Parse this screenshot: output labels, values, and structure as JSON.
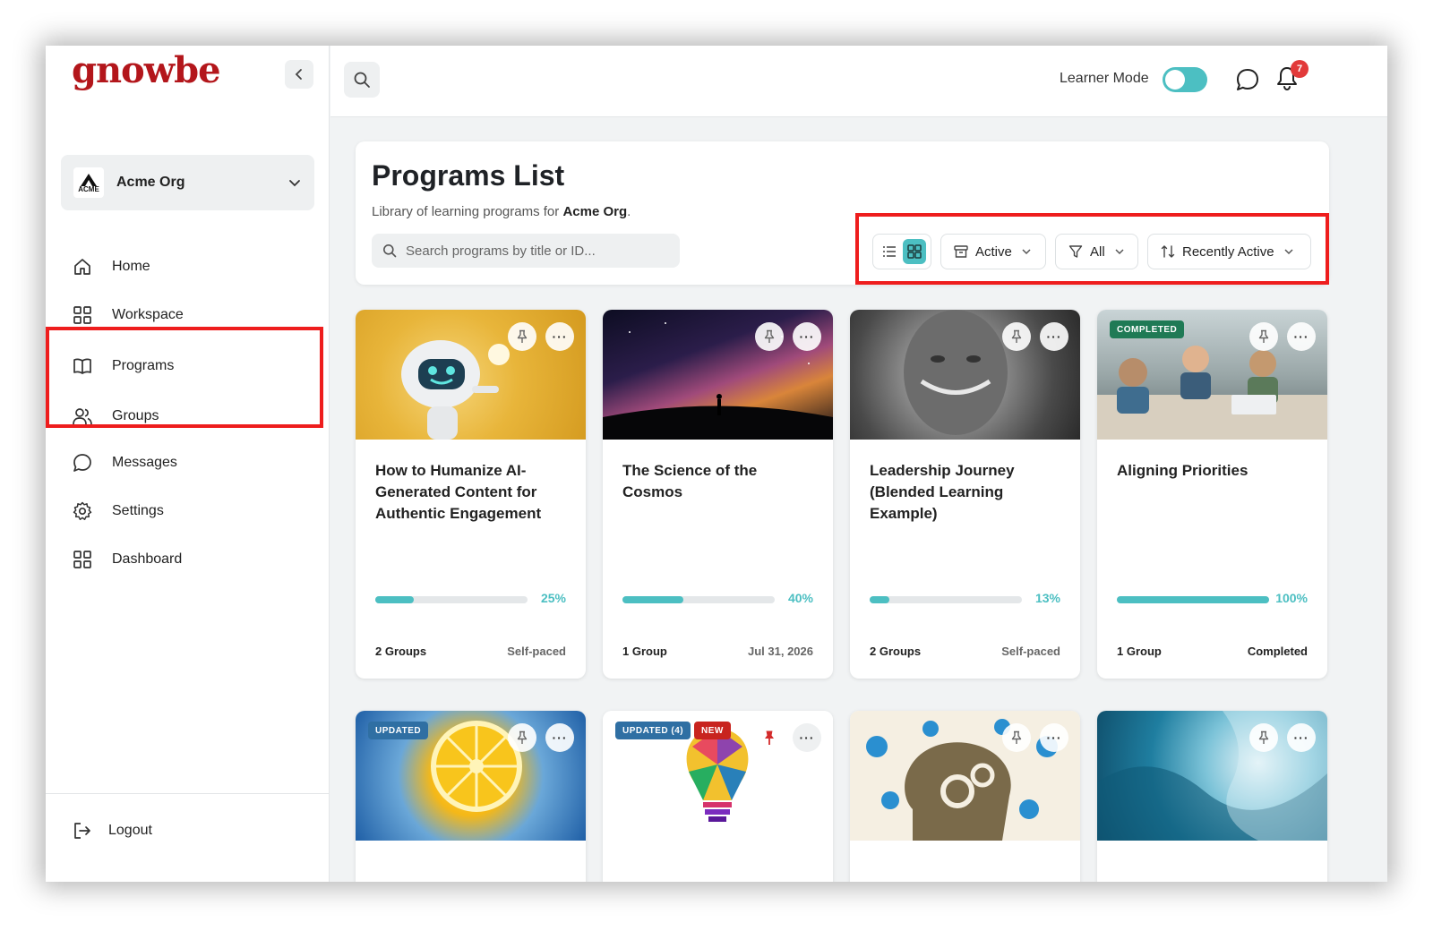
{
  "app": {
    "logo_text": "gnowbe",
    "org": {
      "logo_label": "ACME",
      "name": "Acme Org"
    }
  },
  "sidebar": {
    "items": [
      {
        "label": "Home",
        "icon": "home-icon"
      },
      {
        "label": "Workspace",
        "icon": "grid-icon"
      },
      {
        "label": "Programs",
        "icon": "book-icon"
      },
      {
        "label": "Groups",
        "icon": "users-icon"
      },
      {
        "label": "Messages",
        "icon": "chat-icon"
      },
      {
        "label": "Settings",
        "icon": "gear-icon"
      },
      {
        "label": "Dashboard",
        "icon": "grid-icon"
      }
    ],
    "logout_label": "Logout"
  },
  "topbar": {
    "learner_mode_label": "Learner Mode",
    "learner_mode_on": true,
    "notification_count": "7"
  },
  "header": {
    "title": "Programs List",
    "subtitle_prefix": "Library of learning programs for ",
    "subtitle_org": "Acme Org",
    "subtitle_suffix": ".",
    "search_placeholder": "Search programs by title or ID...",
    "status_filter": "Active",
    "type_filter": "All",
    "sort": "Recently Active",
    "view_mode": "grid"
  },
  "programs": [
    {
      "title": "How to Humanize AI-Generated Content for Authentic Engagement",
      "progress": 25,
      "progress_label": "25%",
      "groups": "2 Groups",
      "meta": "Self-paced",
      "tags": []
    },
    {
      "title": "The Science of the Cosmos",
      "progress": 40,
      "progress_label": "40%",
      "groups": "1 Group",
      "meta": "Jul 31, 2026",
      "tags": []
    },
    {
      "title": "Leadership Journey (Blended Learning Example)",
      "progress": 13,
      "progress_label": "13%",
      "groups": "2 Groups",
      "meta": "Self-paced",
      "tags": []
    },
    {
      "title": "Aligning Priorities",
      "progress": 100,
      "progress_label": "100%",
      "groups": "1 Group",
      "meta": "Completed",
      "tags": [
        "COMPLETED"
      ]
    },
    {
      "title": "",
      "tags": [
        "UPDATED"
      ]
    },
    {
      "title": "",
      "tags": [
        "UPDATED (4)",
        "NEW"
      ],
      "pinned": true
    },
    {
      "title": "",
      "tags": []
    },
    {
      "title": "",
      "tags": []
    }
  ],
  "colors": {
    "accent": "#4cbfc2",
    "brand": "#b3161b",
    "highlight": "#ee1d1d",
    "tag_blue": "#2f6fa3",
    "tag_green": "#1f7a55",
    "tag_red": "#c8241f"
  }
}
